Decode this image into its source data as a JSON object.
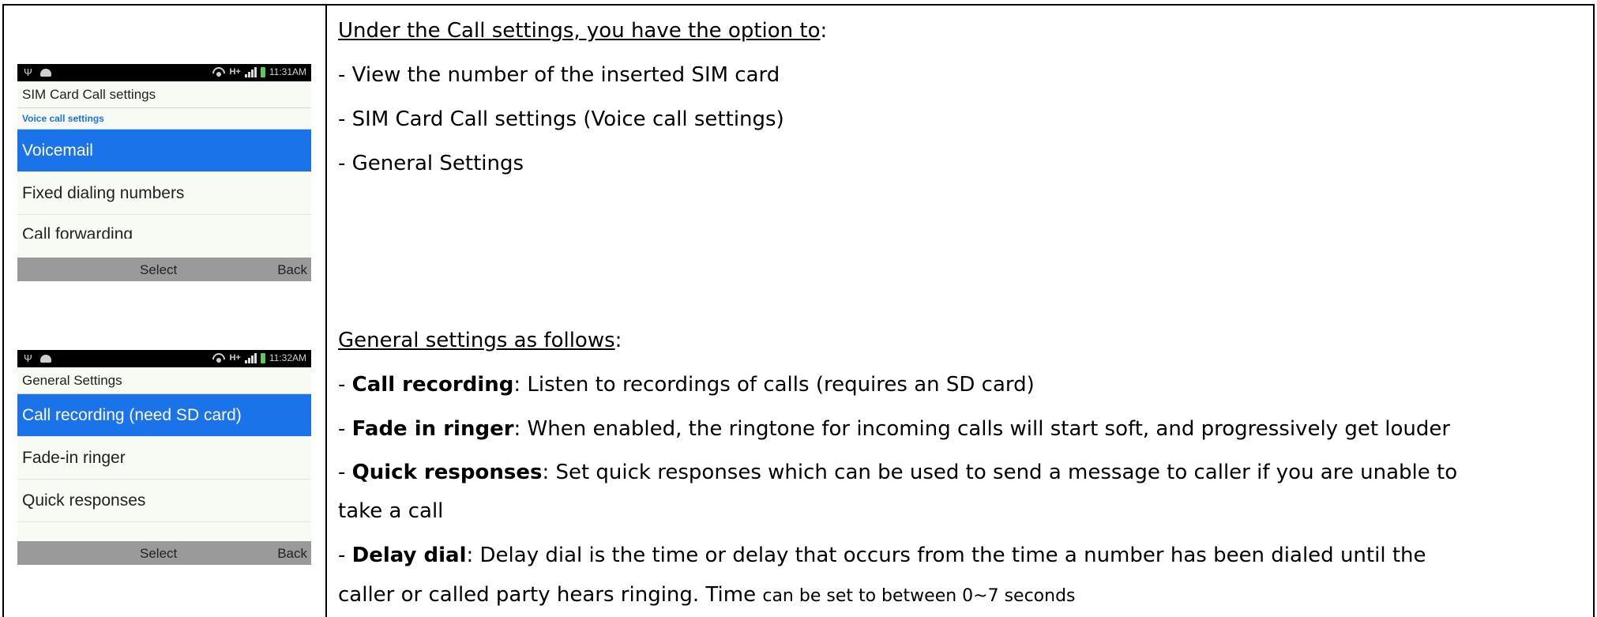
{
  "phone1": {
    "status_time": "11:31AM",
    "network_label": "H+",
    "screen_title": "SIM Card Call settings",
    "section_label": "Voice call settings",
    "items": [
      "Voicemail",
      "Fixed dialing numbers",
      "Call forwarding"
    ],
    "selected_index": 0,
    "softkey_select": "Select",
    "softkey_back": "Back"
  },
  "phone2": {
    "status_time": "11:32AM",
    "network_label": "H+",
    "screen_title": "General Settings",
    "items": [
      "Call recording (need SD card)",
      "Fade-in ringer",
      "Quick responses"
    ],
    "selected_index": 0,
    "softkey_select": "Select",
    "softkey_back": "Back"
  },
  "call_settings": {
    "heading": "Under the Call settings, you have the option to",
    "heading_suffix": ":",
    "lines": [
      "- View the number of the inserted SIM card",
      "- SIM Card Call settings (Voice call settings)",
      "- General Settings"
    ]
  },
  "general_settings": {
    "heading": "General settings as follows",
    "heading_suffix": ":",
    "entries": [
      {
        "prefix": "- ",
        "term": "Call recording",
        "desc": ": Listen to recordings of calls (requires an SD card)"
      },
      {
        "prefix": "- ",
        "term": "Fade in ringer",
        "desc": ": When enabled, the ringtone for incoming calls will start soft, and progressively get louder"
      },
      {
        "prefix": "- ",
        "term": "Quick responses",
        "desc": ": Set quick responses which can be used to send a message to caller if you are unable to",
        "desc_cont": "take a call"
      },
      {
        "prefix": "- ",
        "term": "Delay dial",
        "desc": ": Delay dial is the time or delay that occurs from the time a number has been dialed until the",
        "desc_cont": "caller or called party hears ringing. Time ",
        "desc_cont_small": "can be set to between 0~7 seconds"
      }
    ]
  }
}
